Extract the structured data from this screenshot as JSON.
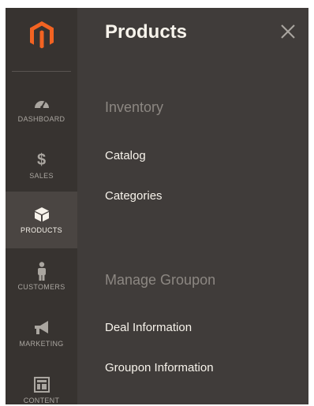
{
  "menu": {
    "items": [
      {
        "label": "DASHBOARD",
        "icon": "gauge-icon"
      },
      {
        "label": "SALES",
        "icon": "dollar-icon"
      },
      {
        "label": "PRODUCTS",
        "icon": "cube-icon",
        "active": true
      },
      {
        "label": "CUSTOMERS",
        "icon": "person-icon"
      },
      {
        "label": "MARKETING",
        "icon": "megaphone-icon"
      },
      {
        "label": "CONTENT",
        "icon": "layout-icon"
      }
    ]
  },
  "panel": {
    "title": "Products",
    "sections": [
      {
        "title": "Inventory",
        "links": [
          "Catalog",
          "Categories"
        ]
      },
      {
        "title": "Manage Groupon",
        "links": [
          "Deal Information",
          "Groupon Information"
        ]
      }
    ]
  },
  "colors": {
    "brand": "#f26322",
    "menu_bg": "#373330",
    "panel_bg": "#403c3a",
    "text": "#f7f3eb",
    "muted": "#8c8782"
  }
}
